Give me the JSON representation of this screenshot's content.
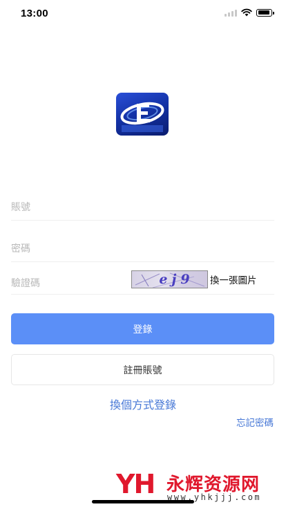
{
  "status_bar": {
    "time": "13:00",
    "signal_icon": "signal-bars-icon",
    "wifi_icon": "wifi-icon",
    "battery_icon": "battery-icon",
    "battery_level": 0.9
  },
  "app_logo": {
    "icon": "app-logo-icon",
    "accent": "#1f43c8"
  },
  "form": {
    "account_placeholder": "賬號",
    "password_placeholder": "密碼",
    "captcha_placeholder": "驗證碼",
    "captcha_text": "ej9",
    "refresh_captcha_label": "換一張圖片"
  },
  "buttons": {
    "login_label": "登錄",
    "register_label": "註冊賬號"
  },
  "links": {
    "switch_login_label": "換個方式登錄",
    "forgot_password_label": "忘記密碼"
  },
  "watermark": {
    "logo_text": "YH",
    "name": "永辉资源网",
    "url": "www.yhkjjj.com"
  },
  "colors": {
    "primary": "#5b8ff7",
    "link": "#4677d6",
    "watermark_red": "#e0182d"
  }
}
